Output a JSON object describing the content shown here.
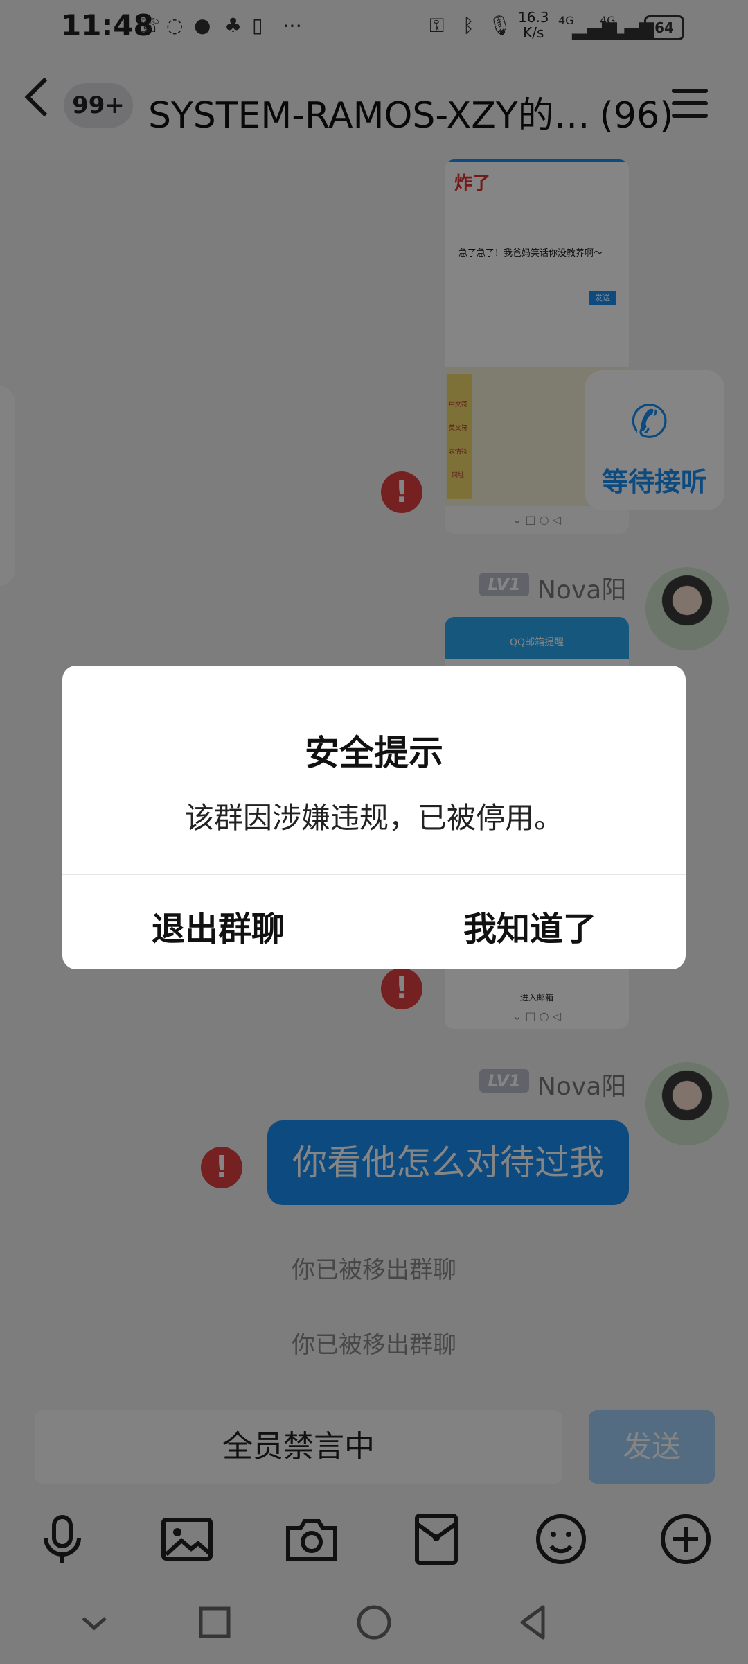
{
  "status_bar": {
    "time": "11:48",
    "net_speed_value": "16.3",
    "net_speed_unit": "K/s",
    "signal_1": "4G",
    "signal_2": "4G",
    "battery": "64"
  },
  "header": {
    "unread_badge": "99+",
    "title": "SYSTEM-RAMOS-XZY的…",
    "member_count": "(96)"
  },
  "messages": {
    "screenshot_1": {
      "title": "炸了",
      "text": "急了急了！我爸妈笑话你没教养啊～",
      "send_label": "发送",
      "keyboard_keys": [
        "中文符",
        "英文符",
        "表情符",
        "网址"
      ]
    },
    "sender": {
      "level": "LV1",
      "name": "Nova阳"
    },
    "screenshot_2": {
      "app_title": "QQ邮箱提醒",
      "footer": "进入邮箱"
    },
    "bubble_text": "你看他怎么对待过我",
    "system_notices": [
      "你已被移出群聊",
      "你已被移出群聊"
    ]
  },
  "floating_call": {
    "label": "等待接听"
  },
  "input": {
    "placeholder": "全员禁言中",
    "send_label": "发送"
  },
  "toolbar": [
    "mic-icon",
    "image-icon",
    "camera-icon",
    "red-packet-icon",
    "emoji-icon",
    "plus-icon"
  ],
  "dialog": {
    "title": "安全提示",
    "message": "该群因涉嫌违规，已被停用。",
    "btn_exit": "退出群聊",
    "btn_ok": "我知道了"
  },
  "colors": {
    "accent": "#1a8ff5",
    "error": "#e04040"
  }
}
